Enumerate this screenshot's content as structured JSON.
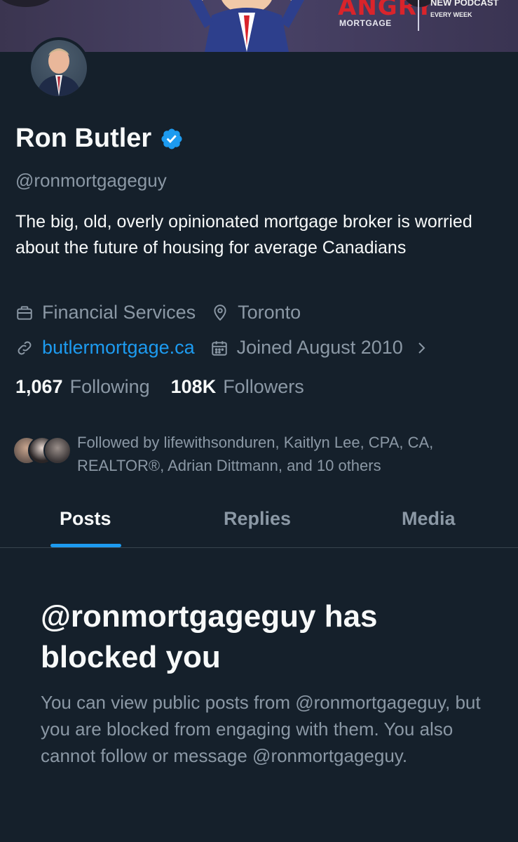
{
  "banner": {
    "brand_title": "ANGRY",
    "brand_sub": "MORTGAGE",
    "podcast_line1": "NEW PODCAST",
    "podcast_line2": "EVERY WEEK"
  },
  "profile": {
    "name": "Ron Butler",
    "handle": "@ronmortgageguy",
    "bio": "The big, old, overly opinionated mortgage broker is worried about the future of housing for average Canadians",
    "category": "Financial Services",
    "location": "Toronto",
    "website": "butlermortgage.ca",
    "joined": "Joined August 2010",
    "following_count": "1,067",
    "following_label": "Following",
    "followers_count": "108K",
    "followers_label": "Followers",
    "followed_by": "Followed by lifewithsonduren, Kaitlyn Lee, CPA, CA, REALTOR®, Adrian Dittmann, and 10 others",
    "verified_color": "#1d9bf0"
  },
  "tabs": [
    {
      "label": "Posts",
      "active": true
    },
    {
      "label": "Replies",
      "active": false
    },
    {
      "label": "Media",
      "active": false
    }
  ],
  "blocked": {
    "title": "@ronmortgageguy has blocked you",
    "description": "You can view public posts from @ronmortgageguy, but you are blocked from engaging with them. You also cannot follow or message @ronmortgageguy."
  },
  "colors": {
    "background": "#15202b",
    "accent": "#1d9bf0",
    "secondary_text": "#8b98a5"
  }
}
